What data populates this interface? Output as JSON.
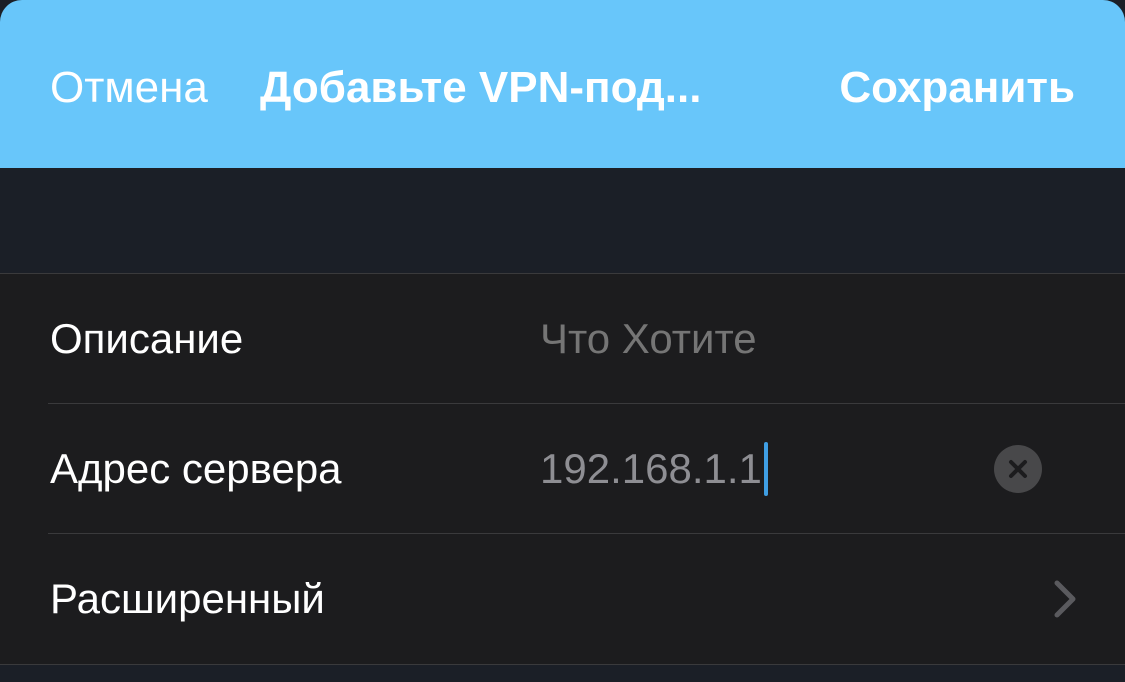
{
  "navbar": {
    "cancel_label": "Отмена",
    "title": "Добавьте VPN-под...",
    "save_label": "Сохранить"
  },
  "form": {
    "description": {
      "label": "Описание",
      "placeholder": "Что Хотите"
    },
    "server": {
      "label": "Адрес сервера",
      "value": "192.168.1.1"
    },
    "advanced": {
      "label": "Расширенный"
    }
  },
  "icons": {
    "clear": "clear-x-circle-icon",
    "disclosure": "chevron-right-icon"
  },
  "colors": {
    "nav_background": "#68c6fa",
    "page_background": "#1b1f27",
    "cell_background": "#1c1c1e",
    "caret": "#3f9ee3"
  }
}
